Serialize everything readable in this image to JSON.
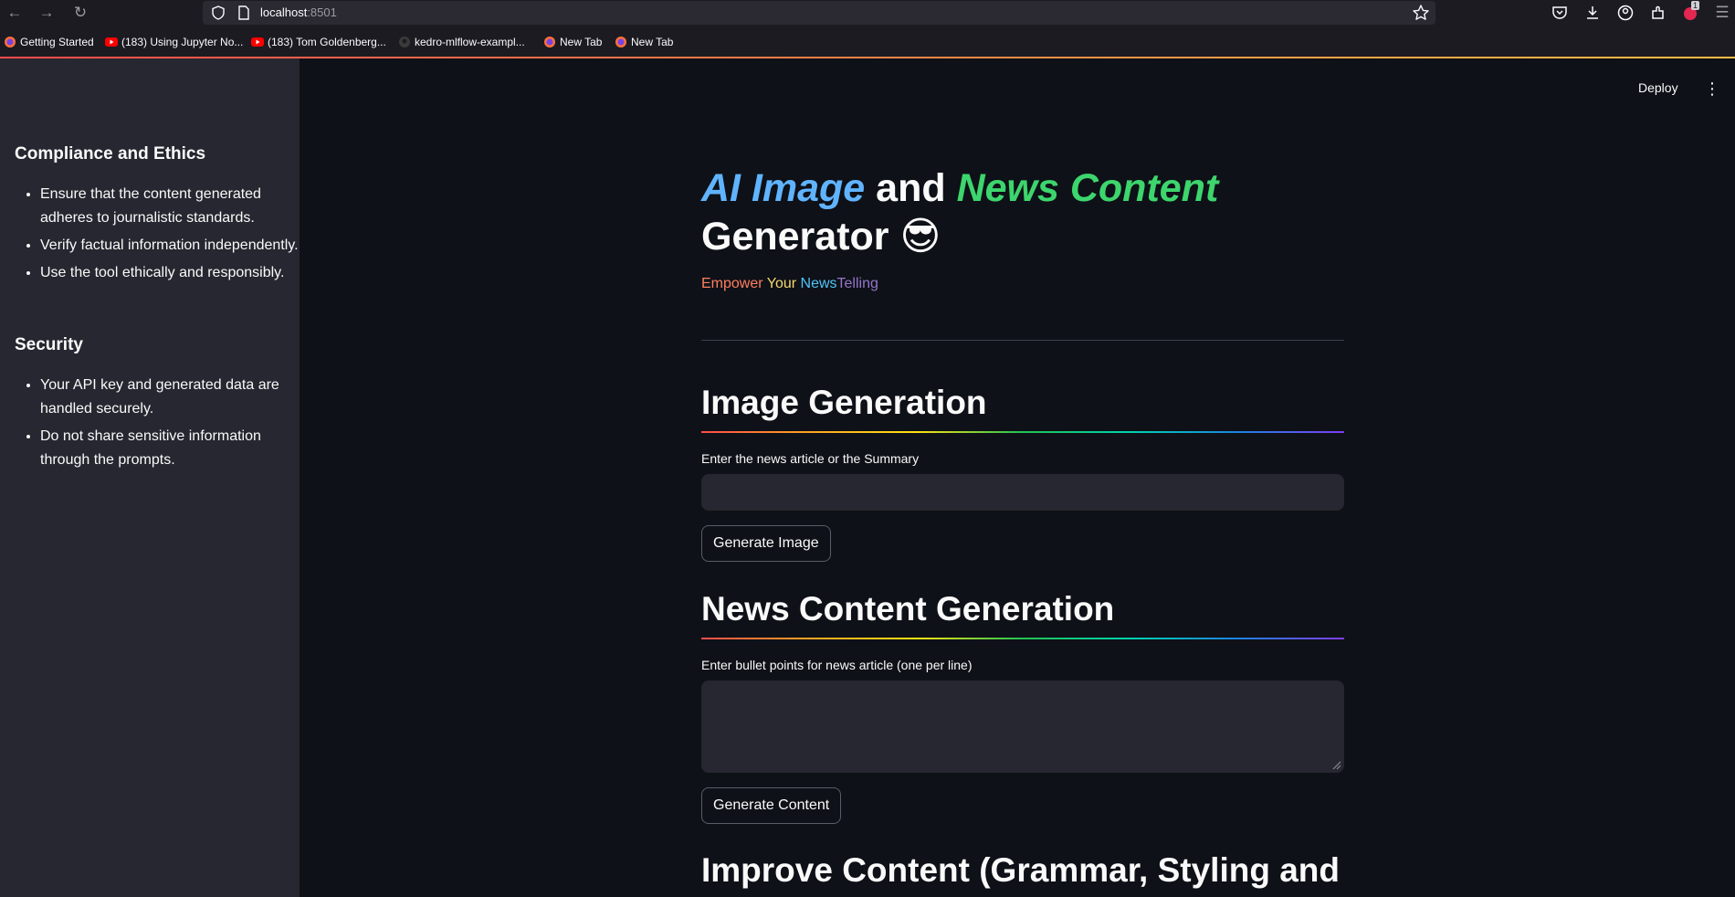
{
  "browser": {
    "url_host": "localhost",
    "url_port": ":8501",
    "bookmarks": [
      {
        "label": "Getting Started",
        "icon": "firefox-icon"
      },
      {
        "label": "(183) Using Jupyter No...",
        "icon": "youtube-icon"
      },
      {
        "label": "(183) Tom Goldenberg...",
        "icon": "youtube-icon"
      },
      {
        "label": "kedro-mlflow-exampl...",
        "icon": "github-icon"
      },
      {
        "label": "New Tab",
        "icon": "firefox-icon"
      },
      {
        "label": "New Tab",
        "icon": "firefox-icon"
      }
    ],
    "extension_badge": "1"
  },
  "header": {
    "deploy_label": "Deploy",
    "menu_icon": "kebab-menu-icon"
  },
  "sidebar": {
    "sections": [
      {
        "heading": "Compliance and Ethics",
        "items": [
          "Ensure that the content generated adheres to journalistic standards.",
          "Verify factual information independently.",
          "Use the tool ethically and responsibly."
        ]
      },
      {
        "heading": "Security",
        "items": [
          "Your API key and generated data are handled securely.",
          "Do not share sensitive information through the prompts."
        ]
      }
    ]
  },
  "main": {
    "title": {
      "part1": "AI Image",
      "part2": " and ",
      "part3": "News Content",
      "part4": "Generator",
      "emoji": "😎"
    },
    "subtitle": {
      "segments": [
        {
          "text": "Empower",
          "color": "#ff7e5f"
        },
        {
          "text": " Your ",
          "color": "#f5d76e"
        },
        {
          "text": "News",
          "color": "#4fc3f7"
        },
        {
          "text": "Telling",
          "color": "#9575cd"
        }
      ]
    },
    "image_section": {
      "heading": "Image Generation",
      "input_label": "Enter the news article or the Summary",
      "input_value": "",
      "button_label": "Generate Image"
    },
    "content_section": {
      "heading": "News Content Generation",
      "input_label": "Enter bullet points for news article (one per line)",
      "input_value": "",
      "button_label": "Generate Content"
    },
    "improve_section": {
      "heading": "Improve Content (Grammar, Styling and"
    }
  },
  "colors": {
    "app_bg": "#0e1117",
    "sidebar_bg": "#262730",
    "title_blue": "#60b4ff",
    "title_green": "#3dd56d"
  }
}
